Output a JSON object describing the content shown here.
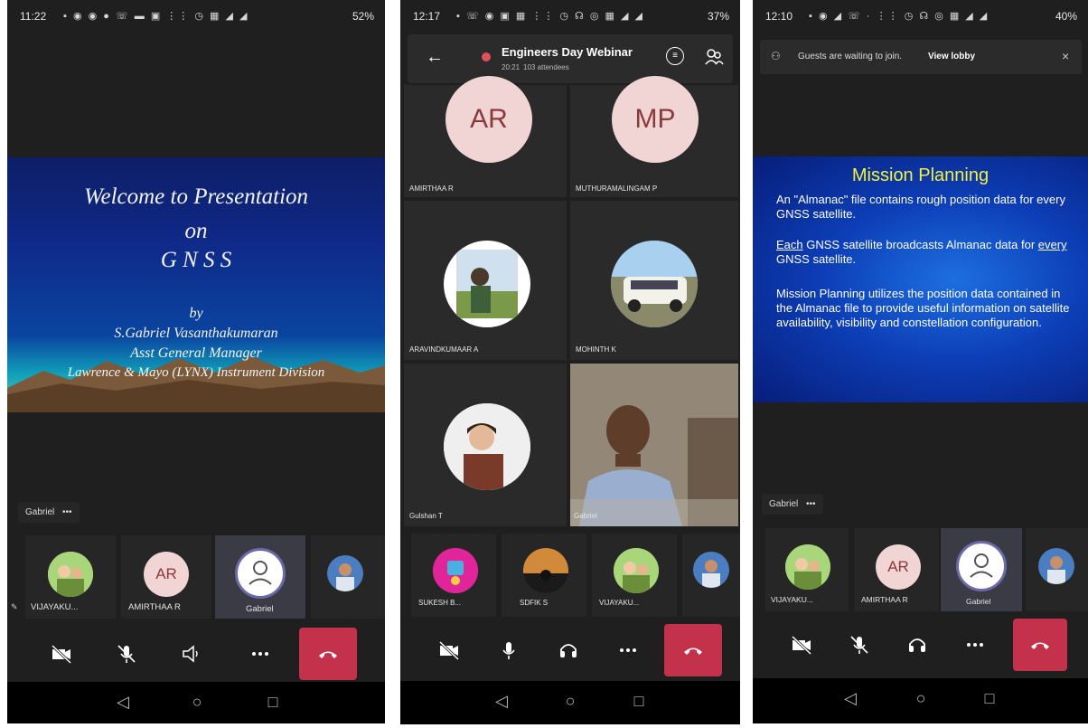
{
  "phone1": {
    "status": {
      "time": "11:22",
      "battery": "52%"
    },
    "slide": {
      "line1": "Welcome to Presentation",
      "line2": "on",
      "line3": "G N S S",
      "by": "by",
      "author": "S.Gabriel Vasanthakumaran",
      "designation": "Asst General Manager",
      "org": "Lawrence & Mayo (LYNX) Instrument Division"
    },
    "presenter": {
      "name": "Gabriel",
      "more": "•••"
    },
    "participants": [
      {
        "name": "VIJAYAKU..."
      },
      {
        "name": "AMIRTHAA R",
        "initials": "AR"
      },
      {
        "name": "Gabriel"
      }
    ]
  },
  "phone2": {
    "status": {
      "time": "12:17",
      "battery": "37%"
    },
    "header": {
      "title": "Engineers Day Webinar",
      "duration": "20:21",
      "attendees": "103 attendees"
    },
    "grid": [
      {
        "name": "AMIRTHAA R",
        "initials": "AR"
      },
      {
        "name": "MUTHURAMALINGAM P",
        "initials": "MP"
      },
      {
        "name": "ARAVINDKUMAAR A"
      },
      {
        "name": "MOHINTH K"
      },
      {
        "name": "Gulshan T"
      },
      {
        "name": "Gabriel"
      }
    ],
    "participants": [
      {
        "name": "SUKESH B..."
      },
      {
        "name": "SDFIK S"
      },
      {
        "name": "VIJAYAKU..."
      }
    ]
  },
  "phone3": {
    "status": {
      "time": "12:10",
      "battery": "40%"
    },
    "lobby": {
      "text": "Guests are waiting to join.",
      "link": "View lobby"
    },
    "slide": {
      "title": "Mission Planning",
      "p1": "An \"Almanac\" file contains rough position data for every GNSS satellite.",
      "p2a": "Each",
      "p2b": " GNSS satellite broadcasts Almanac data for ",
      "p2c": "every",
      "p2d": " GNSS satellite.",
      "p3": "Mission Planning utilizes the position data contained in the Almanac file to provide useful information on satellite availability, visibility and constellation configuration."
    },
    "presenter": {
      "name": "Gabriel",
      "more": "•••"
    },
    "participants": [
      {
        "name": "VIJAYAKU..."
      },
      {
        "name": "AMIRTHAA R",
        "initials": "AR"
      },
      {
        "name": "Gabriel"
      }
    ]
  },
  "icons": {
    "mic_muted": "microphone-muted-icon",
    "headset": "headset-icon",
    "more": "more-options-icon",
    "hangup": "hang-up-icon",
    "camera_off": "camera-off-icon",
    "speaker": "speaker-icon"
  },
  "colors": {
    "hangup": "#c4314b",
    "background": "#1f1f1f",
    "slide3_title": "#f2f23a"
  }
}
